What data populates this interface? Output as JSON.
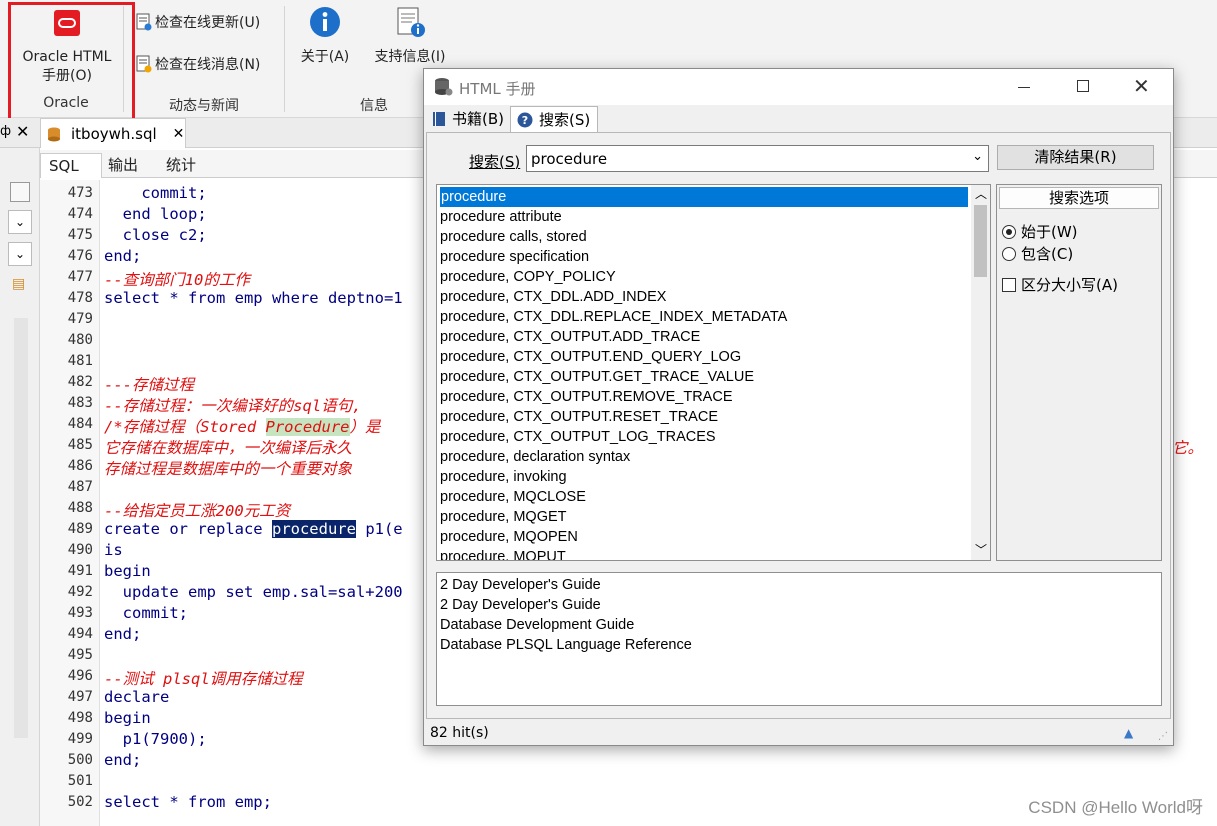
{
  "ribbon": {
    "oracle_button_line1": "Oracle HTML",
    "oracle_button_line2": "手册(O)",
    "oracle_group": "Oracle",
    "check_updates": "检查在线更新(U)",
    "check_news": "检查在线消息(N)",
    "news_group": "动态与新闻",
    "about": "关于(A)",
    "support": "支持信息(I)",
    "info_group": "信息"
  },
  "editor": {
    "file_tab": "itboywh.sql",
    "subtabs": [
      "SQL",
      "输出",
      "统计"
    ],
    "line_numbers": [
      "473",
      "474",
      "475",
      "476",
      "477",
      "478",
      "479",
      "480",
      "481",
      "482",
      "483",
      "484",
      "485",
      "486",
      "487",
      "488",
      "489",
      "490",
      "491",
      "492",
      "493",
      "494",
      "495",
      "496",
      "497",
      "498",
      "499",
      "500",
      "501",
      "502"
    ],
    "code": {
      "l473": "    commit;",
      "l474": "  end loop;",
      "l475": "  close c2;",
      "l476": "end;",
      "l477": "--查询部门10的工作",
      "l478": "select * from emp where deptno=1",
      "l482": "---存储过程",
      "l483": "--存储过程：一次编译好的sql语句,",
      "l484_a": "/*存储过程（Stored ",
      "l484_b": "Procedure",
      "l484_c": "）是",
      "l485": "它存储在数据库中，一次编译后永久",
      "l485_tail": "它。",
      "l486": "存储过程是数据库中的一个重要对象",
      "l488": "--给指定员工涨200元工资",
      "l489_a": "create or replace ",
      "l489_b": "procedure",
      "l489_c": " p1(e",
      "l490": "is",
      "l491": "begin",
      "l492": "  update emp set emp.sal=sal+200",
      "l493": "  commit;",
      "l494": "end;",
      "l496": "--测试 plsql调用存储过程",
      "l497": "declare",
      "l498": "begin",
      "l499": "  p1(7900);",
      "l500": "end;",
      "l502": "select * from emp;"
    }
  },
  "dialog": {
    "title": "HTML 手册",
    "tabs": [
      "书籍(B)",
      "搜索(S)"
    ],
    "search_label": "搜索(S)",
    "search_value": "procedure",
    "clear_button": "清除结果(R)",
    "results": [
      "procedure",
      "procedure attribute",
      "procedure calls, stored",
      "procedure specification",
      "procedure, COPY_POLICY",
      "procedure, CTX_DDL.ADD_INDEX",
      "procedure, CTX_DDL.REPLACE_INDEX_METADATA",
      "procedure, CTX_OUTPUT.ADD_TRACE",
      "procedure, CTX_OUTPUT.END_QUERY_LOG",
      "procedure, CTX_OUTPUT.GET_TRACE_VALUE",
      "procedure, CTX_OUTPUT.REMOVE_TRACE",
      "procedure, CTX_OUTPUT.RESET_TRACE",
      "procedure, CTX_OUTPUT_LOG_TRACES",
      "procedure, declaration syntax",
      "procedure, invoking",
      "procedure, MQCLOSE",
      "procedure, MQGET",
      "procedure, MQOPEN",
      "procedure, MQPUT"
    ],
    "options_title": "搜索选项",
    "opt_starts": "始于(W)",
    "opt_contains": "包含(C)",
    "opt_case": "区分大小写(A)",
    "books": [
      "2 Day Developer's Guide",
      "2 Day Developer's Guide",
      "Database Development Guide",
      "Database PLSQL Language Reference"
    ],
    "status": "82 hit(s)"
  },
  "watermark": "CSDN @Hello World呀"
}
